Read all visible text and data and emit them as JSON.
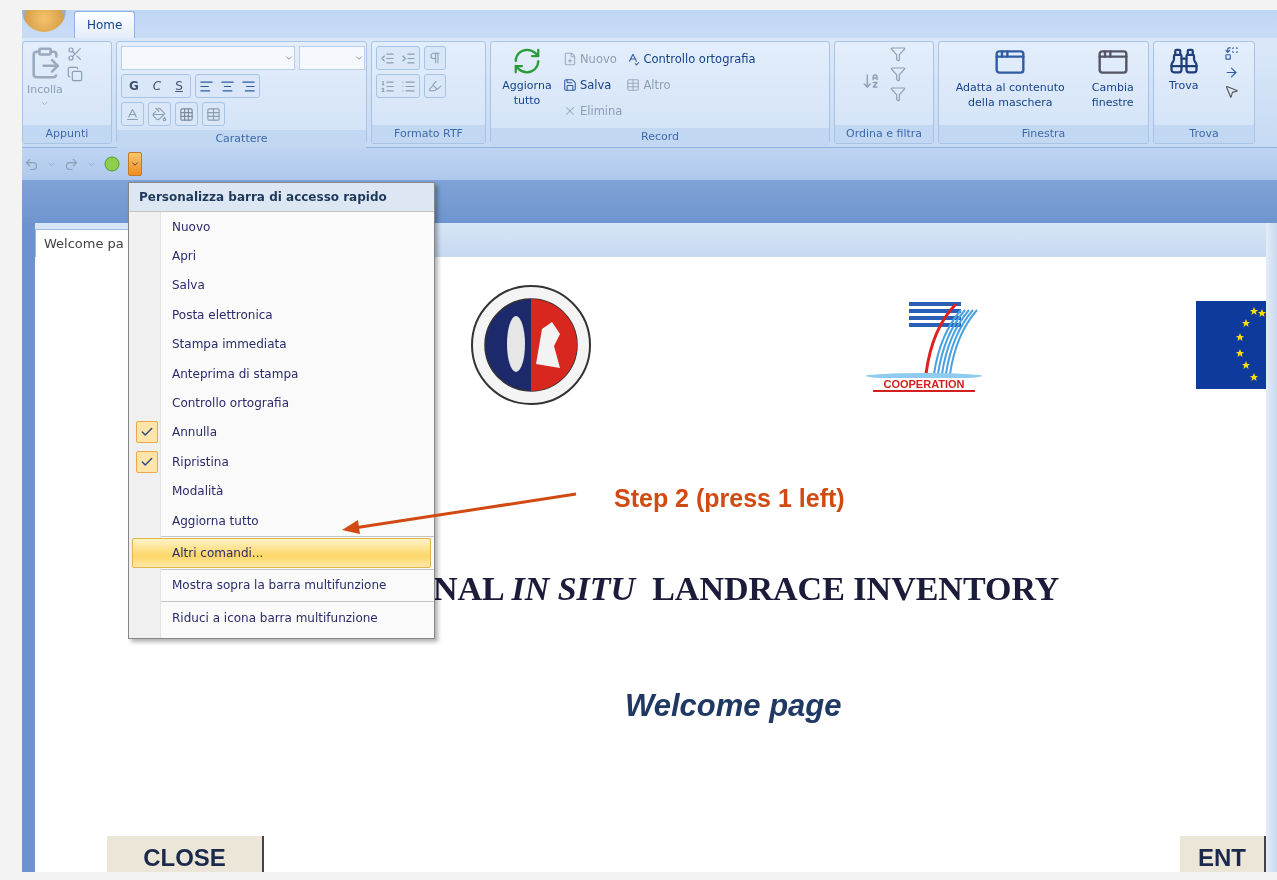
{
  "app_tabs": [
    {
      "label": "Home",
      "selected": true
    }
  ],
  "ribbon": {
    "groups": [
      {
        "kind": "clipboard",
        "label": "Appunti",
        "paste": {
          "label": "Incolla",
          "disabled": true
        }
      },
      {
        "kind": "font",
        "label": "Carattere",
        "styles": [
          "G",
          "C",
          "S"
        ]
      },
      {
        "kind": "rtf",
        "label": "Formato RTF"
      },
      {
        "kind": "record",
        "label": "Record",
        "refresh": "Aggiorna tutto",
        "commands": [
          {
            "label": "Nuovo",
            "disabled": true
          },
          {
            "label": "Salva",
            "disabled": false
          },
          {
            "label": "Elimina",
            "disabled": true
          },
          {
            "label": "Controllo ortografia",
            "disabled": false
          },
          {
            "label": "Altro",
            "disabled": true
          }
        ]
      },
      {
        "kind": "sort",
        "label": "Ordina e filtra"
      },
      {
        "kind": "window",
        "label": "Finestra",
        "commands": [
          "Adatta al contenuto della maschera",
          "Cambia finestre"
        ]
      },
      {
        "kind": "find",
        "label": "Trova",
        "find": "Trova"
      }
    ]
  },
  "quick_access": {
    "menu_open": true
  },
  "menu": {
    "title": "Personalizza barra di accesso rapido",
    "options": [
      {
        "label": "Nuovo",
        "checked": false
      },
      {
        "label": "Apri",
        "checked": false
      },
      {
        "label": "Salva",
        "checked": false
      },
      {
        "label": "Posta elettronica",
        "checked": false
      },
      {
        "label": "Stampa immediata",
        "checked": false
      },
      {
        "label": "Anteprima di stampa",
        "checked": false
      },
      {
        "label": "Controllo ortografia",
        "checked": false
      },
      {
        "label": "Annulla",
        "checked": true
      },
      {
        "label": "Ripristina",
        "checked": true
      },
      {
        "label": "Modalità",
        "checked": false
      },
      {
        "label": "Aggiorna tutto",
        "checked": false
      }
    ],
    "commands": [
      {
        "label": "Altri comandi...",
        "selected": true
      },
      {
        "label": "Mostra sopra la barra multifunzione",
        "selected": false
      },
      {
        "label": "Riduci a icona barra multifunzione",
        "selected": false
      }
    ]
  },
  "document": {
    "tab": "Welcome pa",
    "logo_text": "COOPERATION",
    "title": "NAL *IN SITU*  LANDRACE INVENTORY",
    "subtitle": "Welcome page",
    "buttons": [
      "CLOSE",
      "ENT"
    ]
  },
  "annotation": "Step 2 (press 1 left)"
}
